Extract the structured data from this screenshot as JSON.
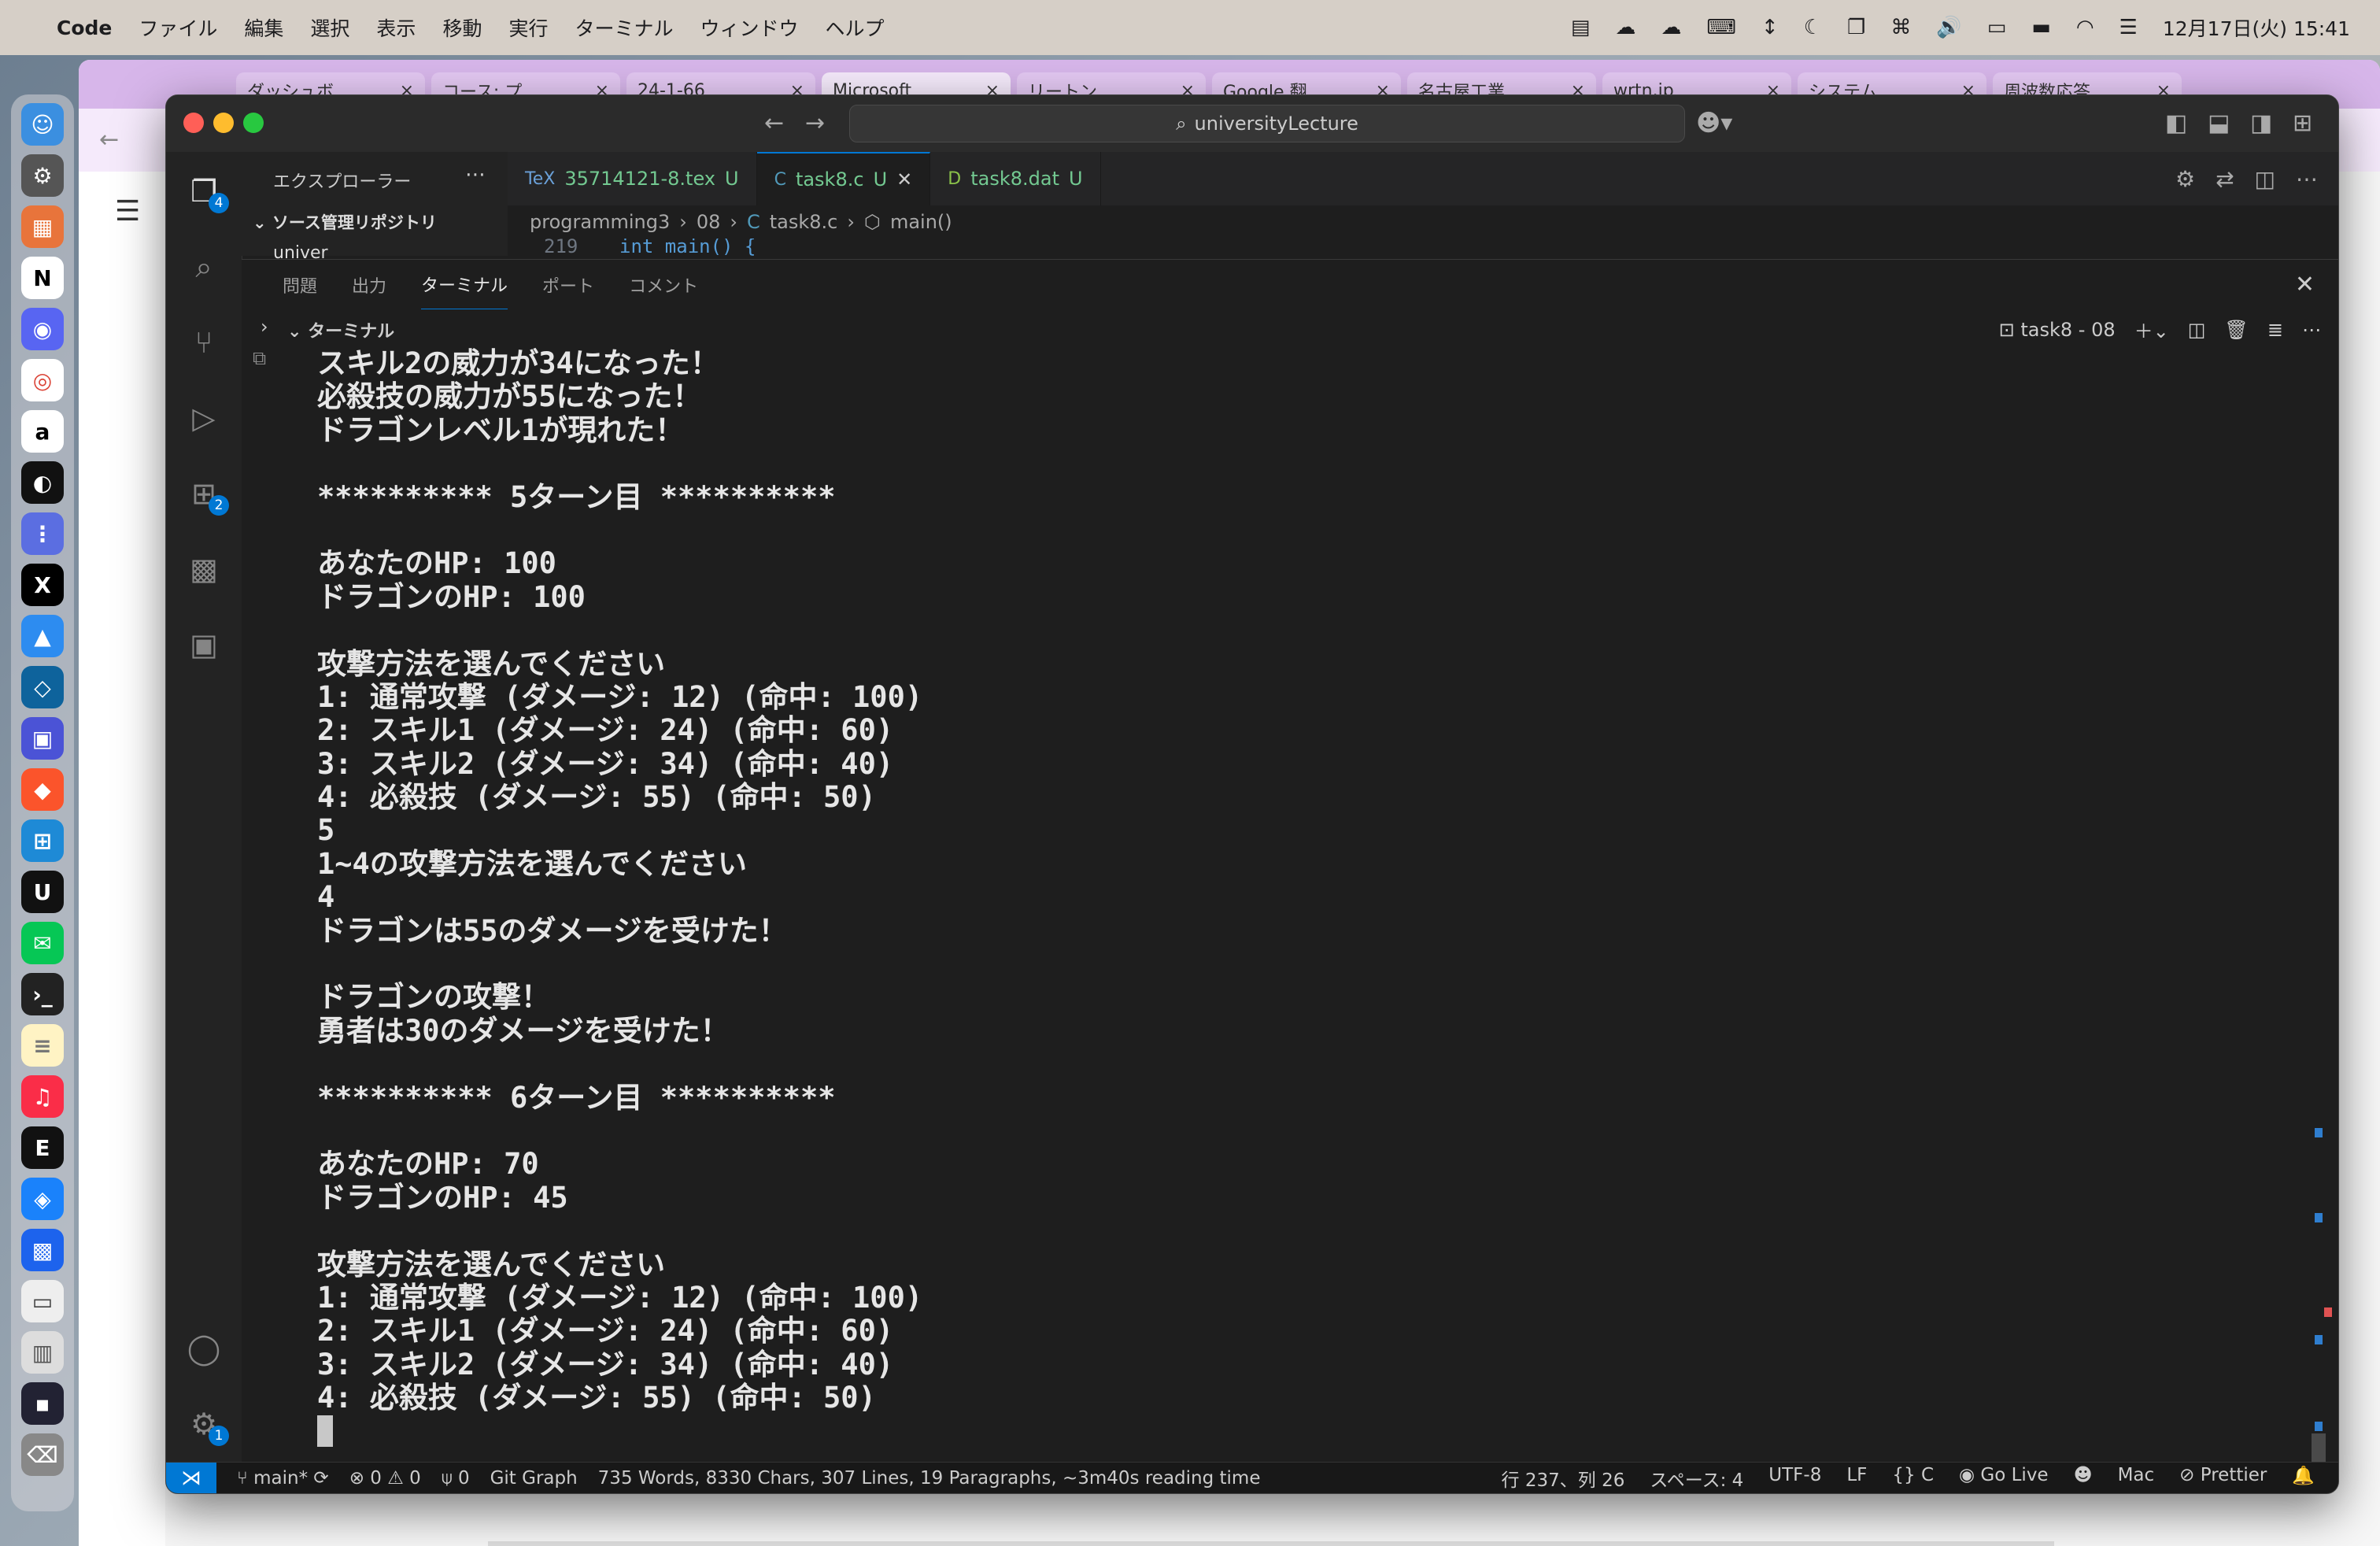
{
  "menubar": {
    "app_name": "Code",
    "items": [
      "ファイル",
      "編集",
      "選択",
      "表示",
      "移動",
      "実行",
      "ターミナル",
      "ウィンドウ",
      "ヘルプ"
    ],
    "datetime": "12月17日(火) 15:41"
  },
  "browser": {
    "tabs": [
      "ダッシュボ",
      "コース: プ",
      "24-1-66",
      "Microsoft",
      "リートン",
      "Google 翻",
      "名古屋工業",
      "wrtn.jp",
      "システム",
      "周波数応答"
    ]
  },
  "vscode": {
    "command_center": "universityLecture",
    "sidebar": {
      "title": "エクスプローラー",
      "section": "ソース管理リポジトリ",
      "repo": "univer"
    },
    "tabs": [
      {
        "label": "35714121-8.tex",
        "status": "U",
        "icon": "TeX"
      },
      {
        "label": "task8.c",
        "status": "U",
        "icon": "C"
      },
      {
        "label": "task8.dat",
        "status": "U",
        "icon": "D"
      }
    ],
    "breadcrumb": [
      "programming3",
      "08",
      "task8.c",
      "main()"
    ],
    "code_peek": {
      "line_no": "219",
      "code": "int main() {"
    },
    "panel_tabs": [
      "問題",
      "出力",
      "ターミナル",
      "ポート",
      "コメント"
    ],
    "terminal_section": "ターミナル",
    "terminal_instance": "task8 - 08",
    "badges": {
      "explorer": "4",
      "extensions": "2",
      "settings": "1"
    }
  },
  "terminal_lines": [
    "スキル2の威力が34になった！",
    "必殺技の威力が55になった！",
    "ドラゴンレベル1が現れた！",
    "",
    "********** 5ターン目 **********",
    "",
    "あなたのHP: 100",
    "ドラゴンのHP: 100",
    "",
    "攻撃方法を選んでください",
    "1: 通常攻撃 (ダメージ: 12) (命中: 100)",
    "2: スキル1 (ダメージ: 24) (命中: 60)",
    "3: スキル2 (ダメージ: 34) (命中: 40)",
    "4: 必殺技 (ダメージ: 55) (命中: 50)",
    "5",
    "1~4の攻撃方法を選んでください",
    "4",
    "ドラゴンは55のダメージを受けた！",
    "",
    "ドラゴンの攻撃！",
    "勇者は30のダメージを受けた！",
    "",
    "********** 6ターン目 **********",
    "",
    "あなたのHP: 70",
    "ドラゴンのHP: 45",
    "",
    "攻撃方法を選んでください",
    "1: 通常攻撃 (ダメージ: 12) (命中: 100)",
    "2: スキル1 (ダメージ: 24) (命中: 60)",
    "3: スキル2 (ダメージ: 34) (命中: 40)",
    "4: 必殺技 (ダメージ: 55) (命中: 50)"
  ],
  "statusbar": {
    "branch": "main*",
    "errors": "0",
    "warnings": "0",
    "ports": "0",
    "git_graph": "Git Graph",
    "word_count": "735 Words, 8330 Chars, 307 Lines, 19 Paragraphs, ~3m40s reading time",
    "position": "行 237、列 26",
    "spaces": "スペース: 4",
    "encoding": "UTF-8",
    "eol": "LF",
    "language": "C",
    "go_live": "Go Live",
    "platform": "Mac",
    "prettier": "Prettier"
  },
  "colors": {
    "accent": "#0078d4",
    "terminal_bg": "#1e1e1e",
    "tab_untracked": "#73c991"
  }
}
